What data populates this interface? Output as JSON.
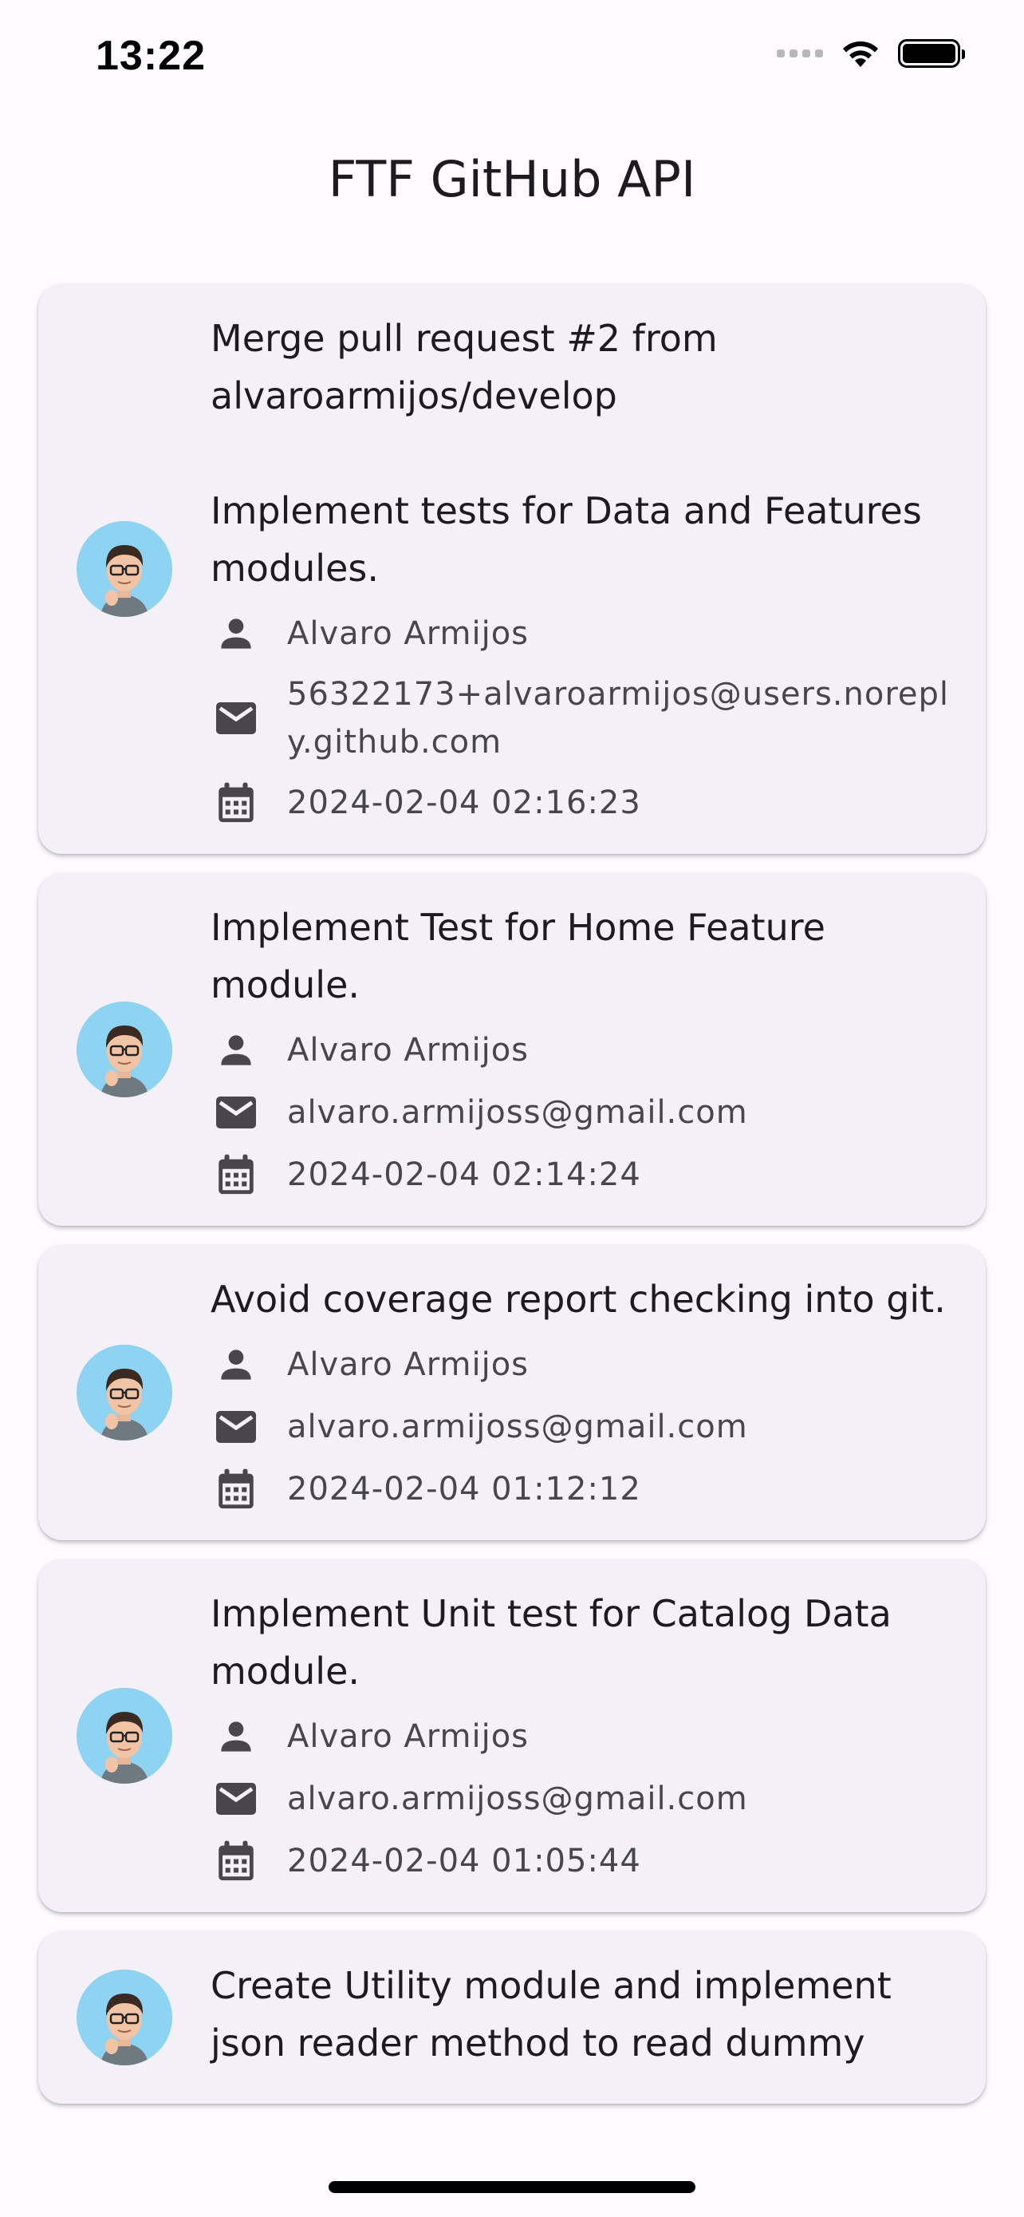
{
  "status_bar": {
    "time": "13:22"
  },
  "app_bar": {
    "title": "FTF GitHub API"
  },
  "commits": [
    {
      "message": "Merge pull request #2 from alvaroarmijos/develop\n\nImplement tests for Data and Features modules.",
      "author": "Alvaro Armijos",
      "email": "56322173+alvaroarmijos@users.noreply.github.com",
      "date": "2024-02-04 02:16:23"
    },
    {
      "message": "Implement Test for Home Feature module.",
      "author": "Alvaro Armijos",
      "email": "alvaro.armijoss@gmail.com",
      "date": "2024-02-04 02:14:24"
    },
    {
      "message": "Avoid coverage report checking into git.",
      "author": "Alvaro Armijos",
      "email": "alvaro.armijoss@gmail.com",
      "date": "2024-02-04 01:12:12"
    },
    {
      "message": "Implement Unit test for Catalog Data module.",
      "author": "Alvaro Armijos",
      "email": "alvaro.armijoss@gmail.com",
      "date": "2024-02-04 01:05:44"
    },
    {
      "message": "Create Utility module and implement json reader method to read dummy",
      "author": "",
      "email": "",
      "date": ""
    }
  ],
  "icons": {
    "author": "person-icon",
    "email": "mail-icon",
    "date": "calendar-icon"
  },
  "colors": {
    "background": "#fdfbff",
    "card": "#f3f1f7",
    "icon": "#49454f",
    "avatar_bg": "#8fd3f2"
  }
}
